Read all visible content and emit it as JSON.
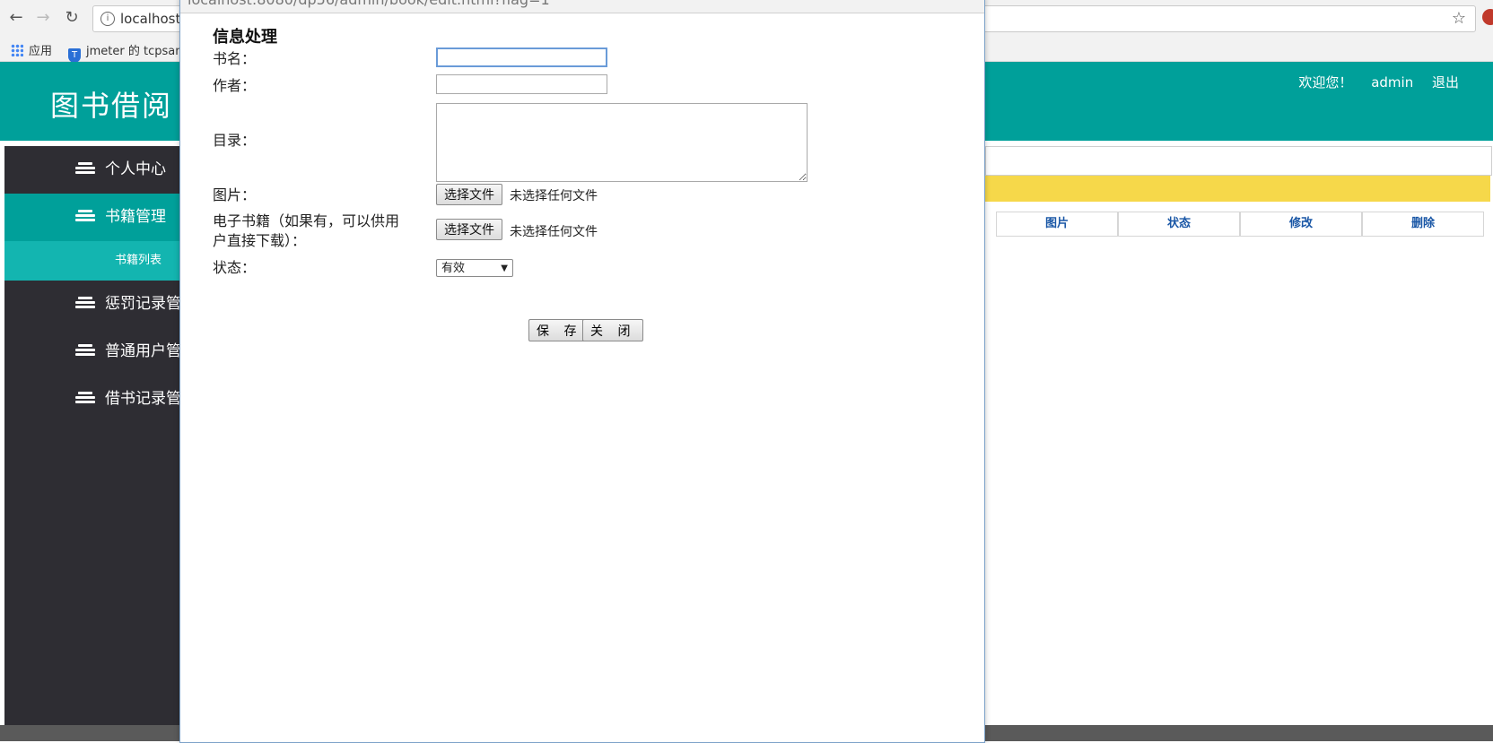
{
  "browser": {
    "url": "localhost:8080/dp56/admin/book/edit.html?flag=1",
    "url_visible": "localhost",
    "bookmarks": [
      {
        "label": "应用",
        "icon": "apps-grid-icon"
      },
      {
        "label": "jmeter 的 tcpsam",
        "icon": "shield-icon"
      }
    ]
  },
  "header": {
    "title": "图书借阅",
    "welcome": "欢迎您！",
    "user": "admin",
    "logout": "退出",
    "color": "#00a09a"
  },
  "sidebar": {
    "items": [
      {
        "label": "个人中心",
        "icon": "stack-icon"
      },
      {
        "label": "书籍管理",
        "icon": "stack-icon",
        "active": true
      },
      {
        "label": "惩罚记录管",
        "icon": "stack-icon"
      },
      {
        "label": "普通用户管",
        "icon": "stack-icon"
      },
      {
        "label": "借书记录管",
        "icon": "stack-icon"
      }
    ],
    "sub_item": "书籍列表"
  },
  "table": {
    "columns": [
      "图片",
      "状态",
      "修改",
      "删除"
    ]
  },
  "dialog": {
    "url": "localhost:8080/dp56/admin/book/edit.html?flag=1",
    "title": "信息处理",
    "fields": {
      "name_label": "书名：",
      "author_label": "作者：",
      "catalog_label": "目录：",
      "image_label": "图片：",
      "ebook_label_line1": "电子书籍（如果有，可以供用",
      "ebook_label_line2": "户直接下载）：",
      "status_label": "状态："
    },
    "file_button": "选择文件",
    "no_file": "未选择任何文件",
    "status_value": "有效",
    "save": "保 存",
    "close": "关 闭"
  }
}
